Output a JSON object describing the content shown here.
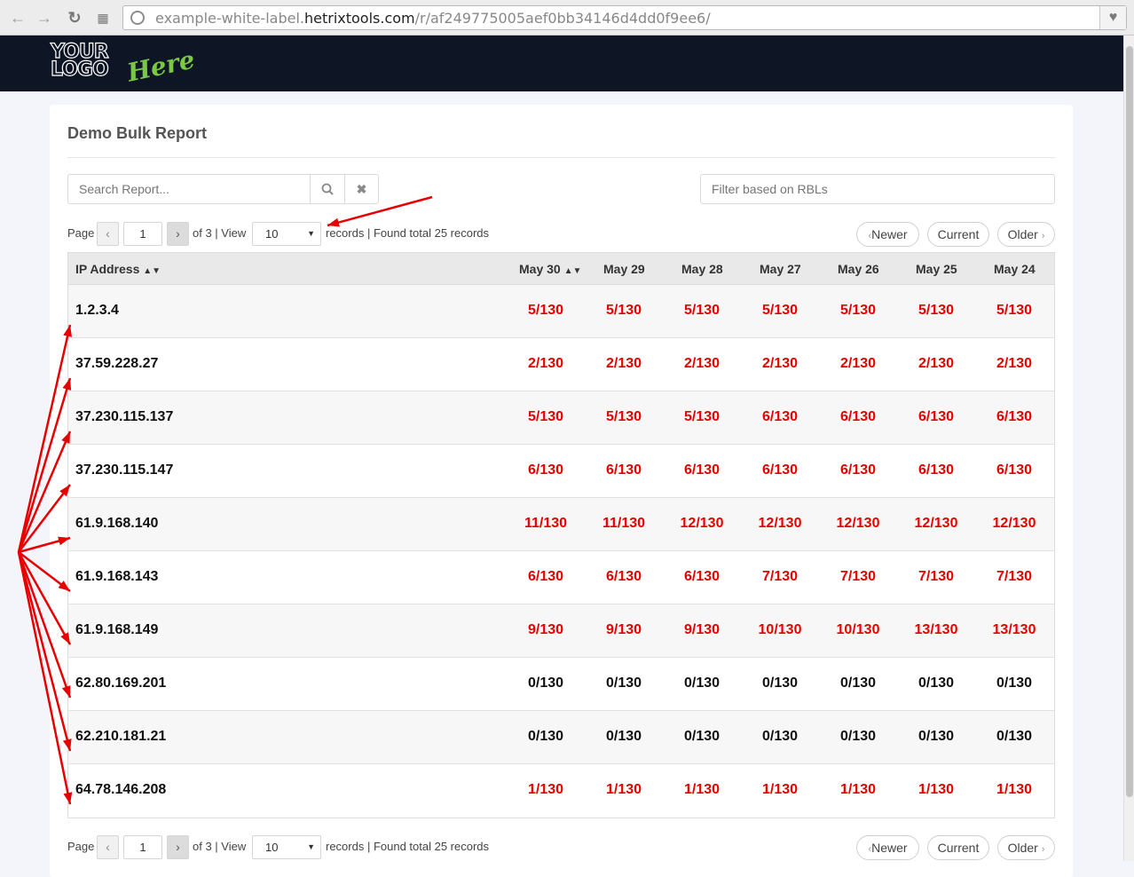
{
  "browser": {
    "url_prefix": "example-white-label.",
    "url_host": "hetrixtools.com",
    "url_path": "/r/af249775005aef0bb34146d4dd0f9ee6/",
    "back_icon": "arrow-left-icon",
    "forward_icon": "arrow-right-icon",
    "reload_icon": "reload-icon",
    "apps_icon": "grid-icon",
    "bookmark_icon": "heart-icon"
  },
  "header": {
    "logo_line1": "YOUR",
    "logo_line2": "LOGO",
    "logo_accent": "Here",
    "bg_color": "#0e1626",
    "accent_color": "#7ac943"
  },
  "report": {
    "title": "Demo Bulk Report",
    "search_placeholder": "Search Report...",
    "rbl_filter_placeholder": "Filter based on RBLs"
  },
  "pagination": {
    "page_label": "Page",
    "current_page": "1",
    "of_pages": "of 3 | View",
    "view_count": "10",
    "records_text": "records | Found total 25 records",
    "newer_label": "Newer",
    "current_label": "Current",
    "older_label": "Older"
  },
  "table": {
    "headers": [
      "IP Address",
      "May 30",
      "May 29",
      "May 28",
      "May 27",
      "May 26",
      "May 25",
      "May 24"
    ],
    "listed_color": "#e60000",
    "clean_color": "#111111",
    "rows": [
      {
        "ip": "1.2.3.4",
        "values": [
          "5/130",
          "5/130",
          "5/130",
          "5/130",
          "5/130",
          "5/130",
          "5/130"
        ]
      },
      {
        "ip": "37.59.228.27",
        "values": [
          "2/130",
          "2/130",
          "2/130",
          "2/130",
          "2/130",
          "2/130",
          "2/130"
        ]
      },
      {
        "ip": "37.230.115.137",
        "values": [
          "5/130",
          "5/130",
          "5/130",
          "6/130",
          "6/130",
          "6/130",
          "6/130"
        ]
      },
      {
        "ip": "37.230.115.147",
        "values": [
          "6/130",
          "6/130",
          "6/130",
          "6/130",
          "6/130",
          "6/130",
          "6/130"
        ]
      },
      {
        "ip": "61.9.168.140",
        "values": [
          "11/130",
          "11/130",
          "12/130",
          "12/130",
          "12/130",
          "12/130",
          "12/130"
        ]
      },
      {
        "ip": "61.9.168.143",
        "values": [
          "6/130",
          "6/130",
          "6/130",
          "7/130",
          "7/130",
          "7/130",
          "7/130"
        ]
      },
      {
        "ip": "61.9.168.149",
        "values": [
          "9/130",
          "9/130",
          "9/130",
          "10/130",
          "10/130",
          "13/130",
          "13/130"
        ]
      },
      {
        "ip": "62.80.169.201",
        "values": [
          "0/130",
          "0/130",
          "0/130",
          "0/130",
          "0/130",
          "0/130",
          "0/130"
        ]
      },
      {
        "ip": "62.210.181.21",
        "values": [
          "0/130",
          "0/130",
          "0/130",
          "0/130",
          "0/130",
          "0/130",
          "0/130"
        ]
      },
      {
        "ip": "64.78.146.208",
        "values": [
          "1/130",
          "1/130",
          "1/130",
          "1/130",
          "1/130",
          "1/130",
          "1/130"
        ]
      }
    ]
  },
  "annotation_color": "#e60000"
}
